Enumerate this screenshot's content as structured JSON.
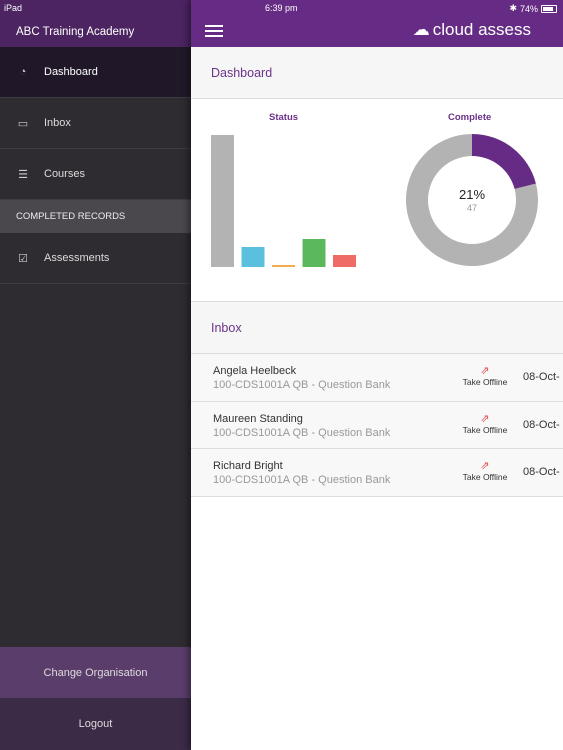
{
  "status_bar": {
    "device": "iPad",
    "time": "6:39 pm",
    "battery": "74%"
  },
  "sidebar": {
    "org": "ABC Training Academy",
    "items": [
      {
        "label": "Dashboard",
        "icon": "pie-chart-icon"
      },
      {
        "label": "Inbox",
        "icon": "inbox-icon"
      },
      {
        "label": "Courses",
        "icon": "list-icon"
      }
    ],
    "section": "COMPLETED RECORDS",
    "section_items": [
      {
        "label": "Assessments",
        "icon": "checkbox-icon"
      }
    ],
    "change_org": "Change Organisation",
    "logout": "Logout"
  },
  "header": {
    "logo": "cloud assess"
  },
  "dashboard": {
    "title": "Dashboard"
  },
  "chart_data": [
    {
      "type": "bar",
      "title": "Status",
      "categories": [
        "",
        "",
        "",
        "",
        ""
      ],
      "values": [
        66,
        10,
        1,
        14,
        6
      ],
      "colors": [
        "#b3b3b3",
        "#5bc0de",
        "#f0ad4e",
        "#5cb85c",
        "#ef6b66"
      ]
    },
    {
      "type": "pie",
      "title": "Complete",
      "donut": true,
      "center_label": "21%",
      "center_sublabel": "47",
      "values": [
        21,
        79
      ],
      "colors": [
        "#662c85",
        "#b3b3b3"
      ]
    }
  ],
  "inbox": {
    "title": "Inbox",
    "rows": [
      {
        "name": "Angela Heelbeck",
        "subtitle": "100-CDS1001A QB - Question Bank",
        "action": "Take Offline",
        "date": "08-Oct-"
      },
      {
        "name": "Maureen Standing",
        "subtitle": "100-CDS1001A QB - Question Bank",
        "action": "Take Offline",
        "date": "08-Oct-"
      },
      {
        "name": "Richard Bright",
        "subtitle": "100-CDS1001A QB - Question Bank",
        "action": "Take Offline",
        "date": "08-Oct-"
      }
    ]
  }
}
